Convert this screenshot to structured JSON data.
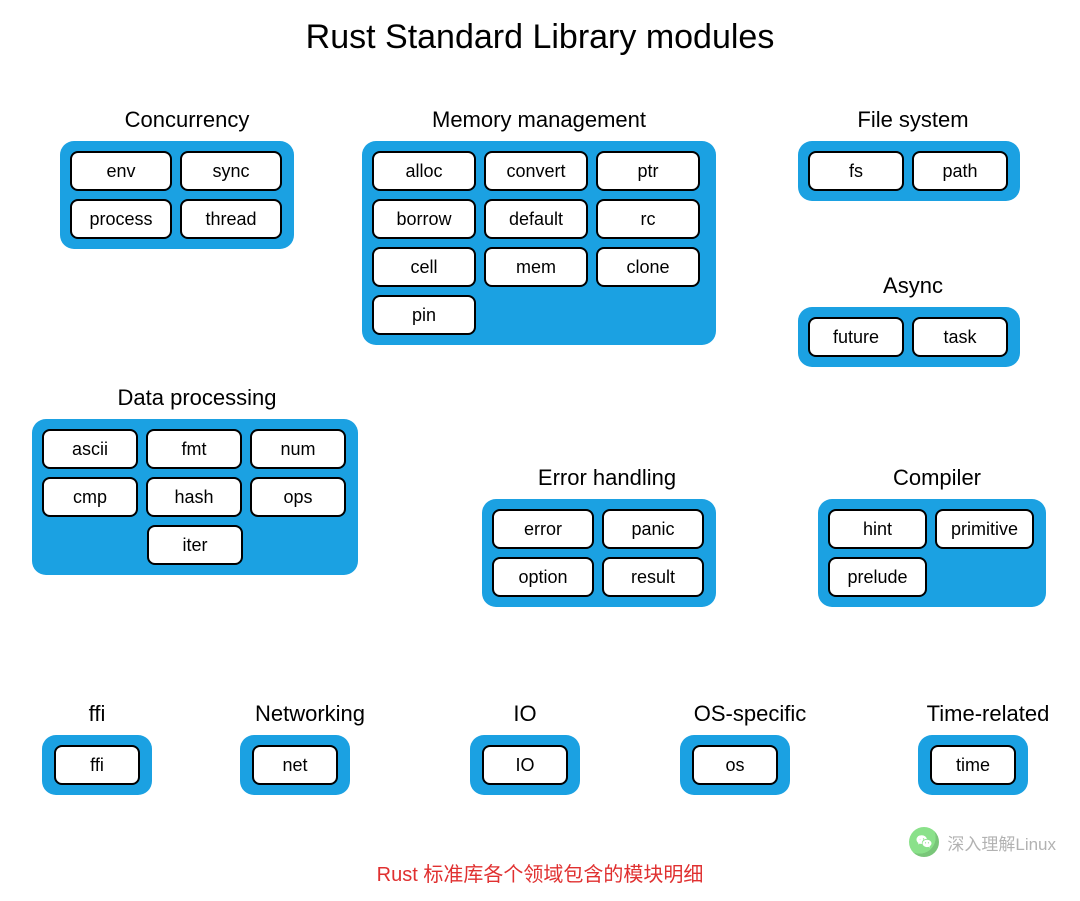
{
  "title": "Rust Standard Library modules",
  "caption": "Rust 标准库各个领域包含的模块明细",
  "watermark": "深入理解Linux",
  "groups": {
    "concurrency": {
      "label": "Concurrency",
      "modules": [
        "env",
        "sync",
        "process",
        "thread"
      ]
    },
    "memory": {
      "label": "Memory management",
      "modules": [
        "alloc",
        "convert",
        "ptr",
        "borrow",
        "default",
        "rc",
        "cell",
        "mem",
        "clone",
        "pin"
      ]
    },
    "filesystem": {
      "label": "File system",
      "modules": [
        "fs",
        "path"
      ]
    },
    "async": {
      "label": "Async",
      "modules": [
        "future",
        "task"
      ]
    },
    "dataproc": {
      "label": "Data processing",
      "modules": [
        "ascii",
        "fmt",
        "num",
        "cmp",
        "hash",
        "ops",
        "iter"
      ]
    },
    "error": {
      "label": "Error handling",
      "modules": [
        "error",
        "panic",
        "option",
        "result"
      ]
    },
    "compiler": {
      "label": "Compiler",
      "modules": [
        "hint",
        "primitive",
        "prelude"
      ]
    },
    "ffi": {
      "label": "ffi",
      "modules": [
        "ffi"
      ]
    },
    "networking": {
      "label": "Networking",
      "modules": [
        "net"
      ]
    },
    "io": {
      "label": "IO",
      "modules": [
        "IO"
      ]
    },
    "os": {
      "label": "OS-specific",
      "modules": [
        "os"
      ]
    },
    "time": {
      "label": "Time-related",
      "modules": [
        "time"
      ]
    }
  }
}
